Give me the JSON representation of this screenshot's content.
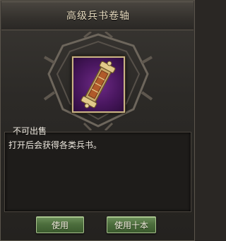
{
  "dialog": {
    "title": "高级兵书卷轴"
  },
  "item": {
    "icon": "scroll-icon",
    "frame_color": "#c9b486",
    "background_color": "#4a1760"
  },
  "description": {
    "line1": "不可出售",
    "line2": "打开后会获得各类兵书。"
  },
  "buttons": {
    "use_label": "使用",
    "use_ten_label": "使用十本"
  }
}
